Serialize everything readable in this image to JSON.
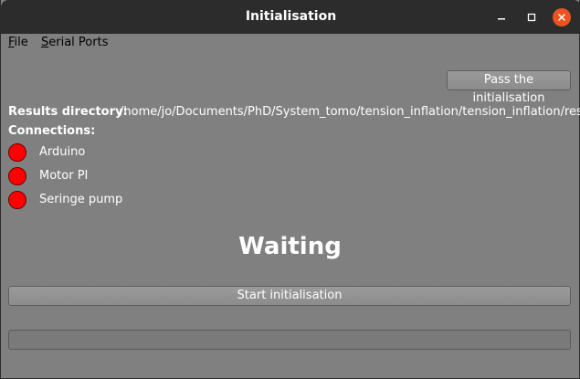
{
  "window": {
    "title": "Initialisation",
    "controls": {
      "minimize_icon": "minimize-icon",
      "maximize_icon": "maximize-icon",
      "close_icon": "close-icon"
    }
  },
  "menubar": {
    "items": [
      {
        "label": "File",
        "mnemonic": "F",
        "rest": "ile"
      },
      {
        "label": "Serial Ports",
        "mnemonic": "S",
        "rest": "erial Ports"
      }
    ]
  },
  "toolbar": {
    "pass_label": "Pass the initialisation"
  },
  "results": {
    "label": "Results directory:",
    "path": "/home/jo/Documents/PhD/System_tomo/tension_inflation/tension_inflation/results/"
  },
  "connections": {
    "label": "Connections:",
    "items": [
      {
        "label": "Arduino",
        "status_color": "#ff0000"
      },
      {
        "label": "Motor PI",
        "status_color": "#ff0000"
      },
      {
        "label": "Seringe pump",
        "status_color": "#ff0000"
      }
    ]
  },
  "status": {
    "text": "Waiting"
  },
  "actions": {
    "start_label": "Start initialisation"
  },
  "progress": {
    "value": 0
  },
  "colors": {
    "background": "#808080",
    "titlebar": "#2c2c2c",
    "close_button": "#e95420",
    "led_off": "#ff0000"
  }
}
